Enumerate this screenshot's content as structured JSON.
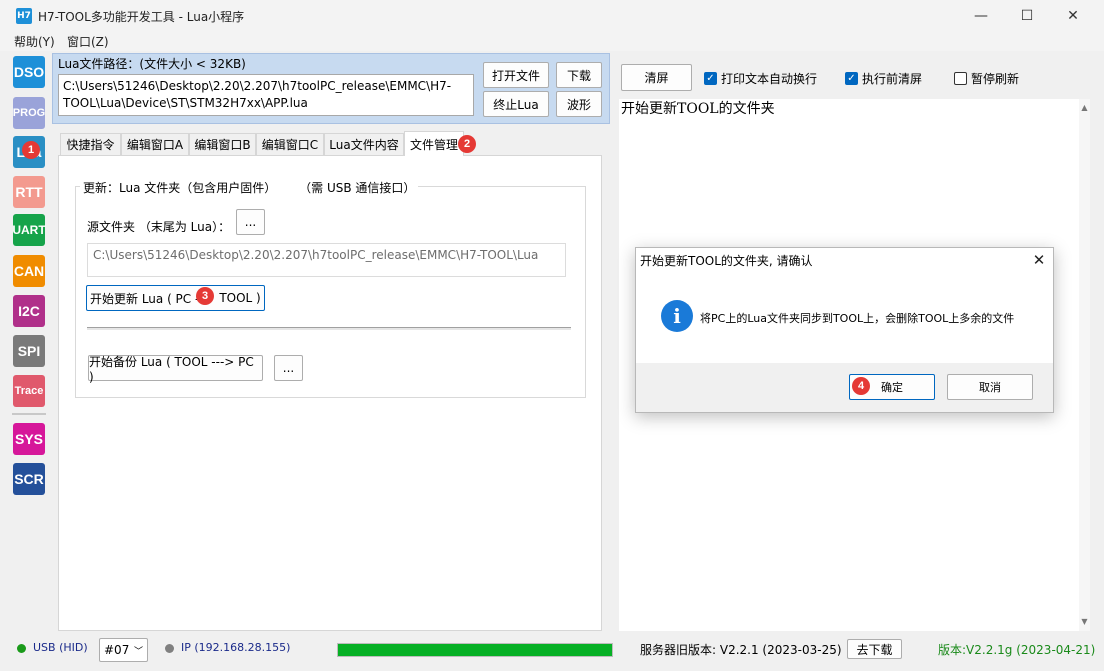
{
  "window": {
    "app_icon_text": "H7",
    "title": "H7-TOOL多功能开发工具 - Lua小程序",
    "minimize_glyph": "—",
    "maximize_glyph": "☐",
    "close_glyph": "✕"
  },
  "menu": {
    "items": [
      "帮助(Y)",
      "窗口(Z)"
    ]
  },
  "toolbar": {
    "tools": [
      {
        "label": "DSO",
        "color": "#1e90d8"
      },
      {
        "label": "PROG",
        "color": "#9aa3d9"
      },
      {
        "label": "Lua",
        "color": "#2a8fc4"
      },
      {
        "label": "RTT",
        "color": "#f39a8f"
      },
      {
        "label": "UART",
        "color": "#16a34a"
      },
      {
        "label": "CAN",
        "color": "#f08c00"
      },
      {
        "label": "I2C",
        "color": "#b0308a"
      },
      {
        "label": "SPI",
        "color": "#7a7a7a"
      },
      {
        "label": "Trace",
        "color": "#e0596c"
      },
      {
        "label": "SYS",
        "color": "#d6179a"
      },
      {
        "label": "SCR",
        "color": "#24509a"
      }
    ]
  },
  "lua_file": {
    "label": "Lua文件路径：(文件大小 < 32KB)",
    "path": "C:\\Users\\51246\\Desktop\\2.20\\2.207\\h7toolPC_release\\EMMC\\H7-\nTOOL\\Lua\\Device\\ST\\STM32H7xx\\APP.lua",
    "buttons": {
      "open": "打开文件",
      "download": "下载",
      "stop": "终止Lua",
      "waveform": "波形"
    }
  },
  "tabs": [
    "快捷指令",
    "编辑窗口A",
    "编辑窗口B",
    "编辑窗口C",
    "Lua文件内容",
    "文件管理"
  ],
  "file_mgmt": {
    "group_title": "更新：Lua 文件夹（包含用户固件）      （需 USB 通信接口）",
    "source_label": "源文件夹   （末尾为 Lua）：",
    "browse_label": "...",
    "source_path": "C:\\Users\\51246\\Desktop\\2.20\\2.207\\h7toolPC_release\\EMMC\\H7-TOOL\\Lua",
    "update_btn_left": "开始更新 Lua ( PC -",
    "update_btn_right": "TOOL )",
    "backup_btn": "开始备份 Lua ( TOOL ---> PC )",
    "backup_browse": "..."
  },
  "output_panel": {
    "clear_btn": "清屏",
    "options": [
      {
        "label": "打印文本自动换行",
        "checked": true
      },
      {
        "label": "执行前清屏",
        "checked": true
      },
      {
        "label": "暂停刷新",
        "checked": false
      }
    ],
    "text": "开始更新TOOL的文件夹"
  },
  "dialog": {
    "title": "开始更新TOOL的文件夹, 请确认",
    "close_glyph": "✕",
    "icon_glyph": "i",
    "message": "将PC上的Lua文件夹同步到TOOL上，会删除TOOL上多余的文件",
    "ok": "确定",
    "cancel": "取消"
  },
  "badges": [
    "1",
    "2",
    "3",
    "4"
  ],
  "status": {
    "usb": "USB (HID)",
    "port": "#07",
    "port_arrow": "﹀",
    "ip": "IP (192.168.28.155)",
    "progress": 1.0,
    "server_version": "服务器旧版本: V2.2.1 (2023-03-25)",
    "download_btn": "去下载",
    "version": "版本:V2.2.1g (2023-04-21)",
    "usb_dot_color": "#1a9a1a",
    "ip_dot_color": "#808080",
    "version_color": "#1a8a1a"
  }
}
